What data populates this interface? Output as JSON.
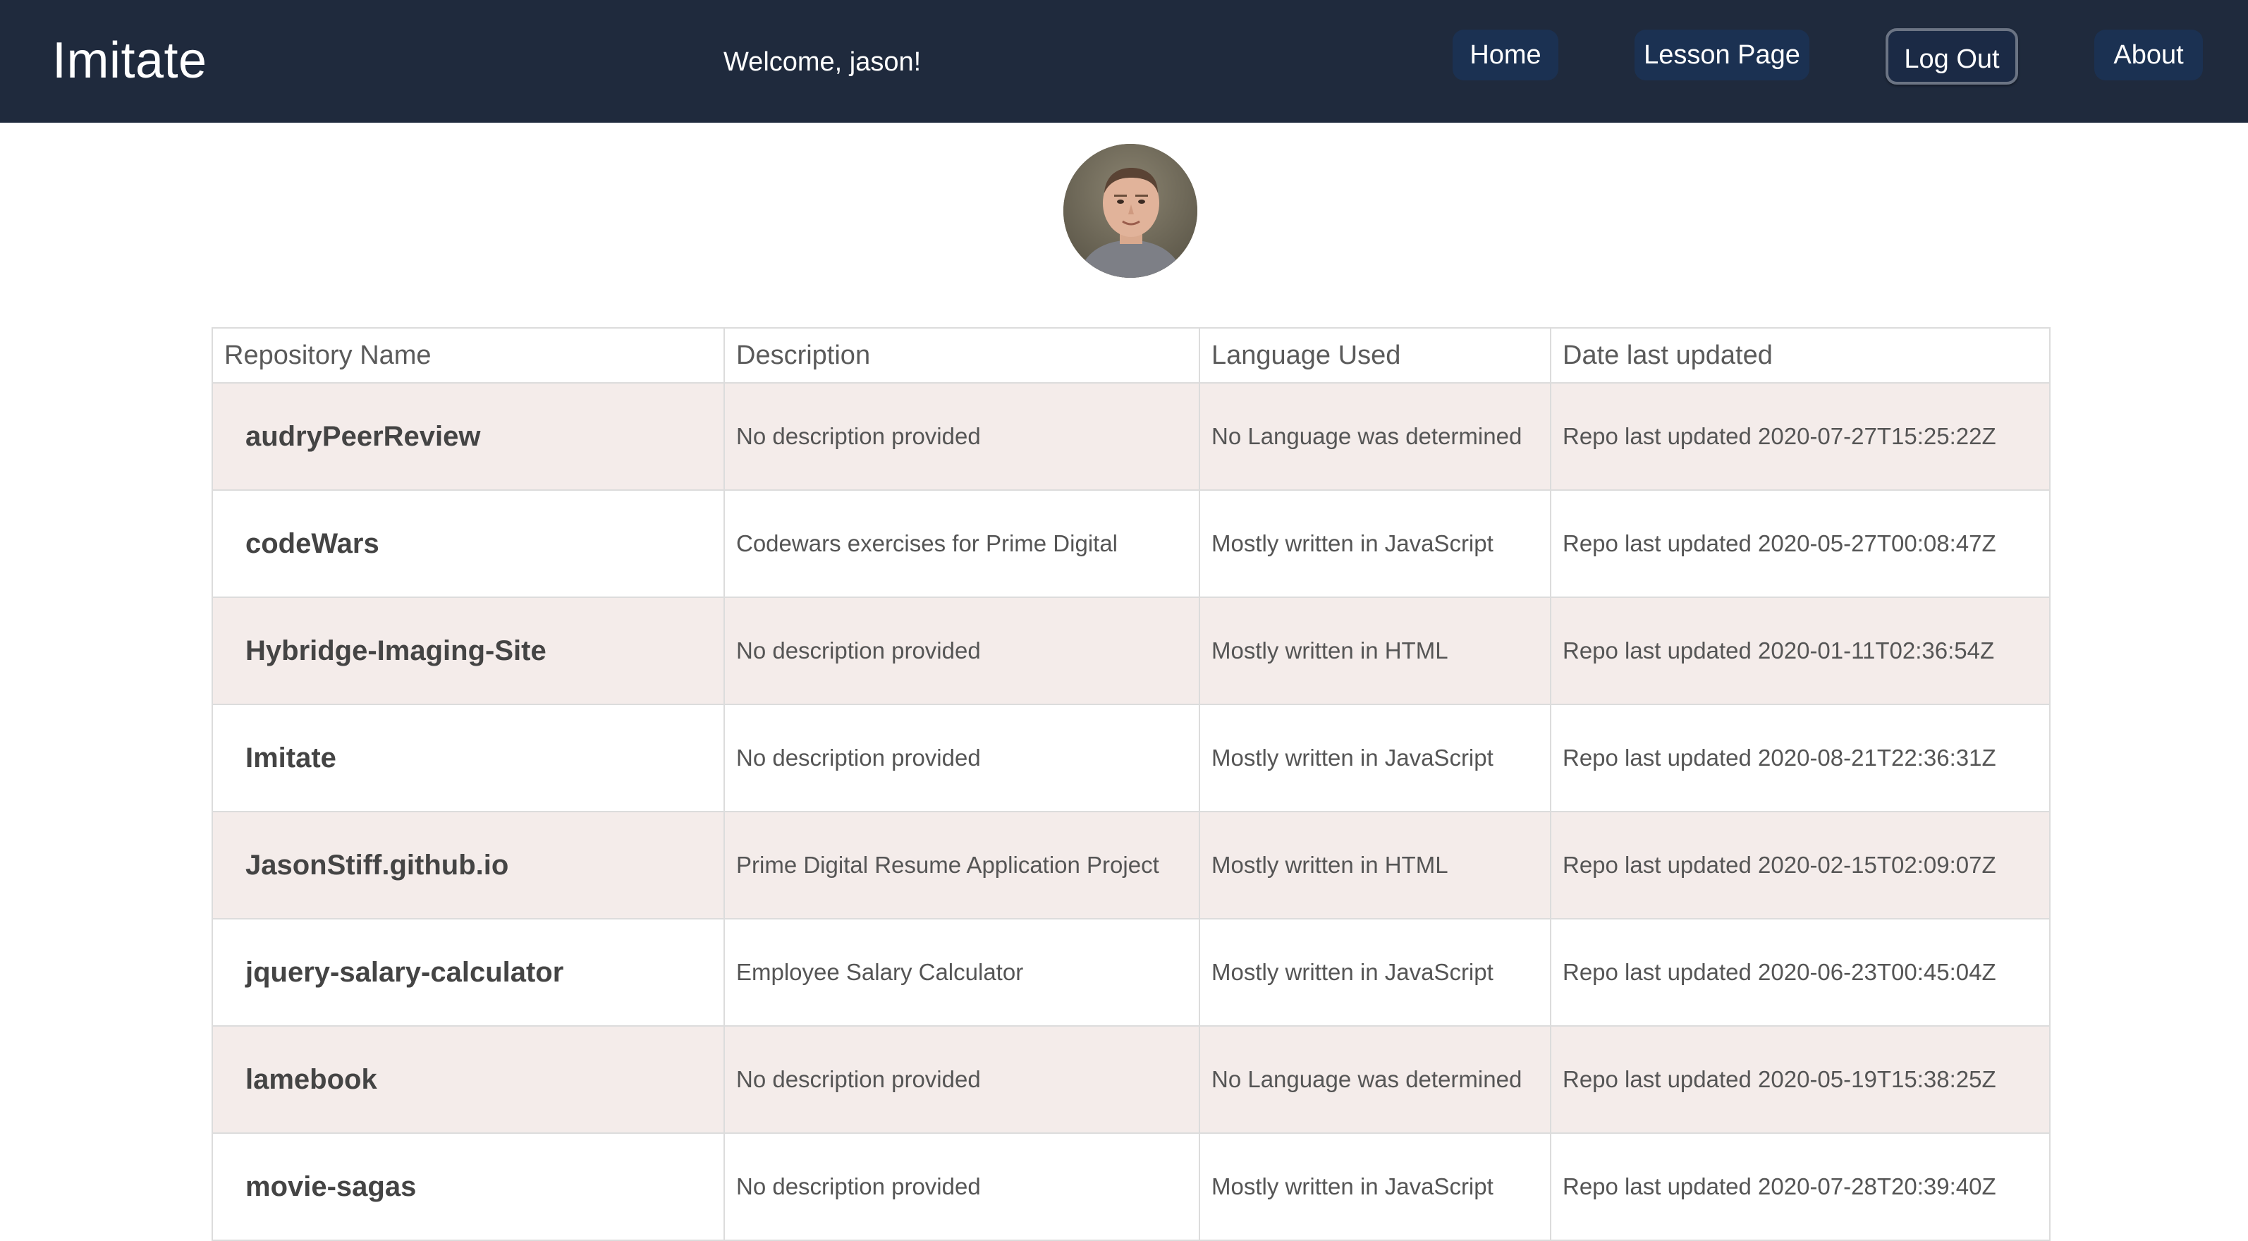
{
  "header": {
    "brand": "Imitate",
    "welcome": "Welcome, jason!",
    "nav": {
      "home": "Home",
      "lesson": "Lesson Page",
      "logout": "Log Out",
      "about": "About"
    },
    "colors": {
      "bar": "#1f2a3d",
      "button": "#1b3152"
    }
  },
  "profile": {
    "avatar_icon": "user-photo-avatar"
  },
  "table": {
    "headers": [
      "Repository Name",
      "Description",
      "Language Used",
      "Date last updated"
    ],
    "rows": [
      {
        "name": "audryPeerReview",
        "description": "No description provided",
        "language": "No Language was determined",
        "updated": "Repo last updated 2020-07-27T15:25:22Z"
      },
      {
        "name": "codeWars",
        "description": "Codewars exercises for Prime Digital",
        "language": "Mostly written in JavaScript",
        "updated": "Repo last updated 2020-05-27T00:08:47Z"
      },
      {
        "name": "Hybridge-Imaging-Site",
        "description": "No description provided",
        "language": "Mostly written in HTML",
        "updated": "Repo last updated 2020-01-11T02:36:54Z"
      },
      {
        "name": "Imitate",
        "description": "No description provided",
        "language": "Mostly written in JavaScript",
        "updated": "Repo last updated 2020-08-21T22:36:31Z"
      },
      {
        "name": "JasonStiff.github.io",
        "description": "Prime Digital Resume Application Project",
        "language": "Mostly written in HTML",
        "updated": "Repo last updated 2020-02-15T02:09:07Z"
      },
      {
        "name": "jquery-salary-calculator",
        "description": "Employee Salary Calculator",
        "language": "Mostly written in JavaScript",
        "updated": "Repo last updated 2020-06-23T00:45:04Z"
      },
      {
        "name": "lamebook",
        "description": "No description provided",
        "language": "No Language was determined",
        "updated": "Repo last updated 2020-05-19T15:38:25Z"
      },
      {
        "name": "movie-sagas",
        "description": "No description provided",
        "language": "Mostly written in JavaScript",
        "updated": "Repo last updated 2020-07-28T20:39:40Z"
      }
    ],
    "colors": {
      "stripe": "#f4ecea",
      "border": "#dcdcdc"
    }
  }
}
